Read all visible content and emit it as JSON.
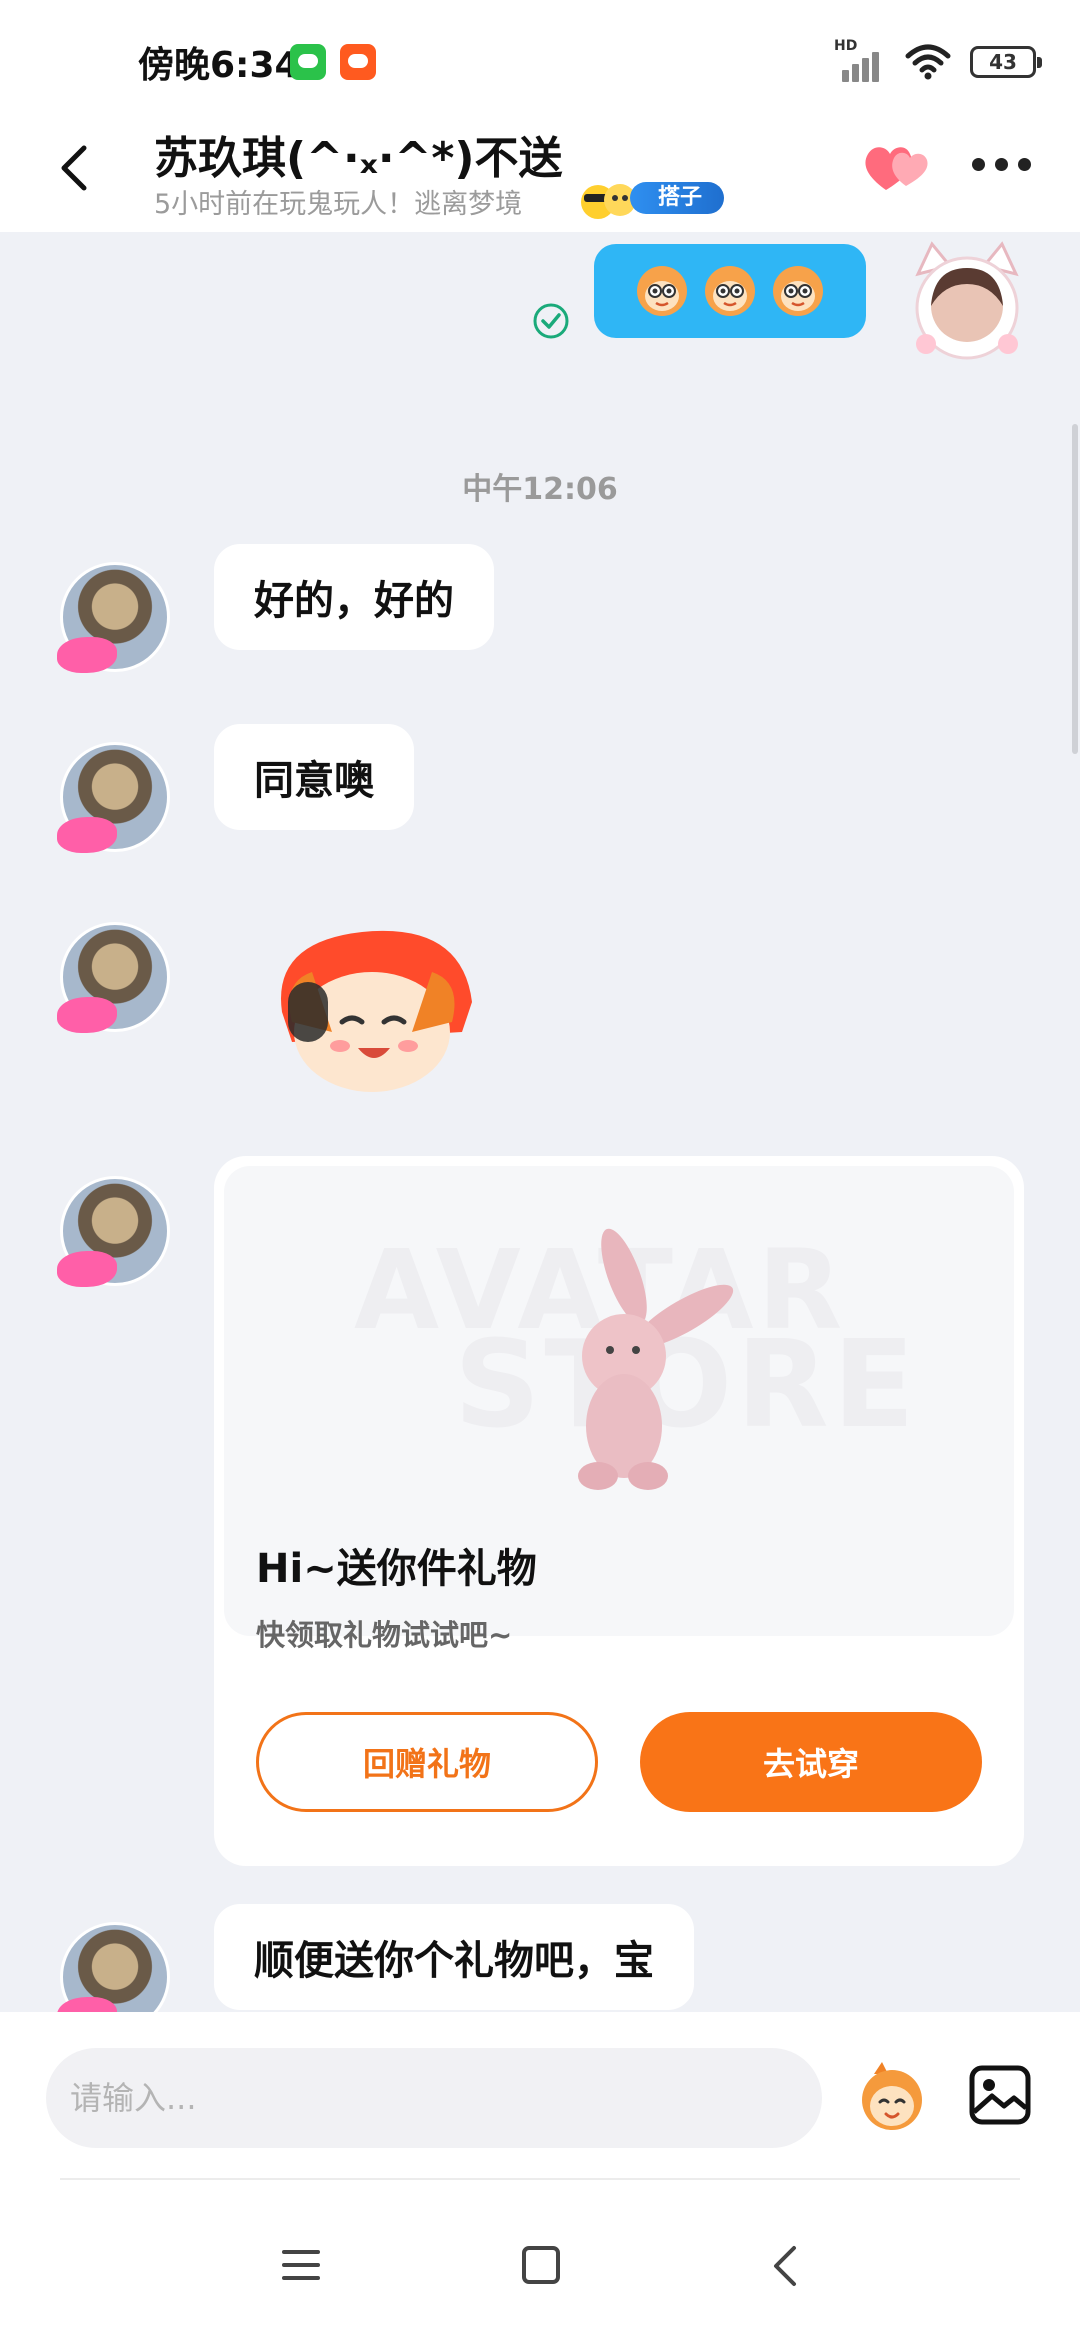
{
  "status_bar": {
    "time": "傍晚6:34",
    "battery": "43",
    "network_label": "HD"
  },
  "header": {
    "title": "苏玖琪(^·ₓ·^*)不送",
    "subtitle": "5小时前在玩鬼玩人！逃离梦境",
    "partner_badge": "搭子"
  },
  "chat": {
    "time_divider": "中午12:06",
    "messages": [
      {
        "text": "好的，好的"
      },
      {
        "text": "同意噢"
      },
      {
        "text": "顺便送你个礼物吧，宝"
      }
    ],
    "gift_card": {
      "title": "Hi~送你件礼物",
      "subtitle": "快领取礼物试试吧~",
      "return_button": "回赠礼物",
      "try_button": "去试穿",
      "watermark_1": "AVATAR",
      "watermark_2": "STORE"
    }
  },
  "input": {
    "placeholder": "请输入..."
  },
  "colors": {
    "accent_orange": "#f97417",
    "sent_bubble_blue": "#2fb6f5",
    "read_check_green": "#1aaa7a",
    "partner_badge_blue": "#2f8ff0"
  }
}
